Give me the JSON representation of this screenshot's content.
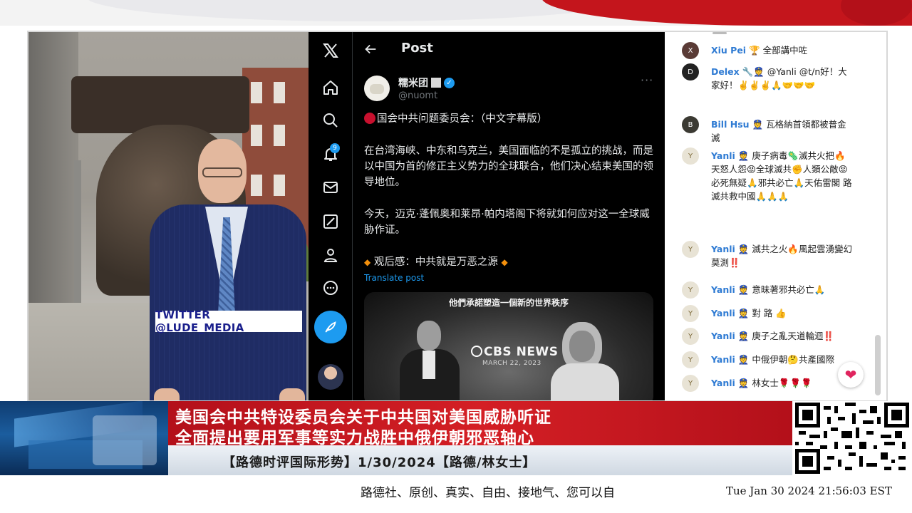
{
  "banner": {
    "accent_colors": [
      "#c4151c",
      "#e9e9ec"
    ]
  },
  "video": {
    "overlay_tag": "TWITTER  @LUDE_MEDIA"
  },
  "x_app": {
    "header_title": "Post",
    "nav_icons": [
      "x-logo-icon",
      "home-icon",
      "search-icon",
      "bell-icon",
      "mail-icon",
      "grok-icon",
      "profile-icon",
      "more-icon",
      "post-feather-icon"
    ],
    "notification_count": "9",
    "post": {
      "author_name": "糯米团",
      "author_handle": "@nuomt",
      "more": "···",
      "line1": "国会中共问题委员会：（中文字幕版）",
      "para1": "在台湾海峡、中东和乌克兰，美国面临的不是孤立的挑战，而是以中国为首的修正主义势力的全球联合，他们决心结束美国的领导地位。",
      "para2": "今天，迈克·蓬佩奥和莱昂·帕内塔阁下将就如何应对这一全球威胁作证。",
      "para3": "观后感：中共就是万恶之源",
      "translate_label": "Translate post",
      "media": {
        "subtitle": "他們承諾塑造一個新的世界秩序",
        "network": "CBS NEWS",
        "date": "MARCH 22, 2023"
      }
    },
    "colors": {
      "accent": "#1d9bf0",
      "background": "#000000"
    }
  },
  "chat": {
    "messages": [
      {
        "name": "Xiu Pei",
        "badge": "🏆",
        "text": "全部講中咗",
        "avatar": "X"
      },
      {
        "name": "Delex",
        "badge": "🔧👮",
        "text": "@Yanli @t/n好！大家好！✌️✌️✌️🙏🤝🤝🤝",
        "avatar": "D"
      },
      {
        "name": "Bill Hsu",
        "badge": "👮",
        "text": "瓦格納首領都被普金滅",
        "avatar": "B"
      },
      {
        "name": "Yanli",
        "badge": "👮",
        "text": "庚子病毒🦠滅共火把🔥天怒人怨😡全球滅共✊人類公敵😡必死無疑🙏邪共必亡🙏天佑雷閣 路 滅共救中國🙏🙏🙏",
        "avatar": "Y"
      },
      {
        "name": "Yanli",
        "badge": "👮",
        "text": "滅共之火🔥風起雲湧變幻莫測‼️",
        "avatar": "Y"
      },
      {
        "name": "Yanli",
        "badge": "👮",
        "text": "意昧著邪共必亡🙏",
        "avatar": "Y"
      },
      {
        "name": "Yanli",
        "badge": "👮",
        "text": "對 路 👍",
        "avatar": "Y"
      },
      {
        "name": "Yanli",
        "badge": "👮",
        "text": "庚子之亂天道輪迴‼️",
        "avatar": "Y"
      },
      {
        "name": "Yanli",
        "badge": "👮",
        "text": "中俄伊朝🤔共產國際",
        "avatar": "Y"
      },
      {
        "name": "Yanli",
        "badge": "👮",
        "text": "林女士🌹🌹🌹",
        "avatar": "Y"
      }
    ],
    "reaction": "❤"
  },
  "lower_third": {
    "headline_1": "美国会中共特设委员会关于中共国对美国威胁听证",
    "headline_2": "全面提出要用军事等实力战胜中俄伊朝邪恶轴心",
    "subtitle": "【路德时评国际形势】1/30/2024【路德/林女士】",
    "headline_color": "#c4151c"
  },
  "footer": {
    "scroll_text": "路德社、原创、真实、自由、接地气、您可以自",
    "clock": "Tue Jan 30 2024 21:56:03 EST"
  }
}
